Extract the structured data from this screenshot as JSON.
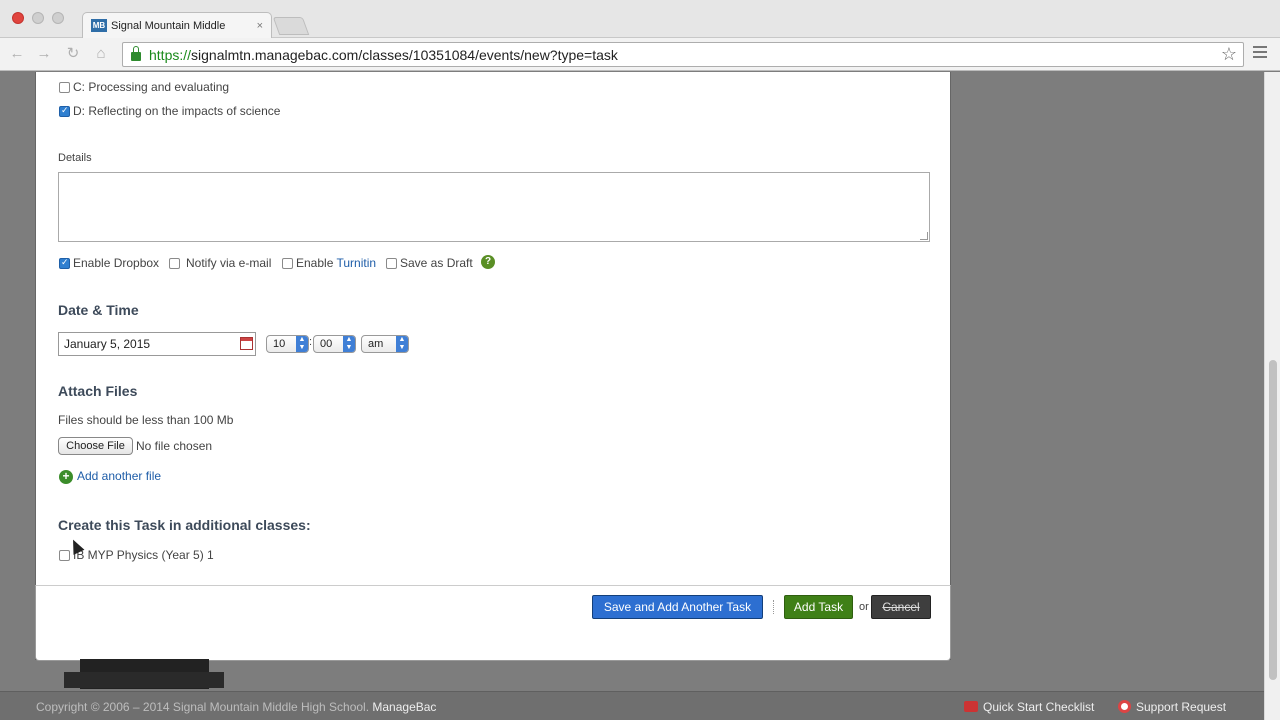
{
  "browser": {
    "tab": {
      "favicon": "MB",
      "title": "Signal Mountain Middle",
      "close": "×"
    },
    "url": {
      "scheme": "https://",
      "rest": "signalmtn.managebac.com/classes/10351084/events/new?type=task"
    },
    "icons": {
      "back": "back-arrow-icon",
      "forward": "forward-arrow-icon",
      "reload": "reload-icon",
      "home": "home-icon",
      "bookmark": "star-icon",
      "menu": "hamburger-menu-icon"
    }
  },
  "criteria": {
    "items": [
      {
        "label": "C: Processing and evaluating",
        "checked": false
      },
      {
        "label": "D: Reflecting on the impacts of science",
        "checked": true
      }
    ]
  },
  "details": {
    "label": "Details",
    "value": ""
  },
  "options": {
    "dropbox": {
      "label": "Enable Dropbox",
      "checked": true
    },
    "notify": {
      "label": "Notify via e-mail",
      "checked": false
    },
    "turnitin_prefix": "Enable ",
    "turnitin_link": "Turnitin",
    "turnitin_checked": false,
    "draft": {
      "label": "Save as Draft",
      "checked": false
    },
    "help": "?"
  },
  "datetime": {
    "heading": "Date & Time",
    "date": "January 5, 2015",
    "hour": "10",
    "minute": "00",
    "ampm": "am",
    "separator": ":"
  },
  "files": {
    "heading": "Attach Files",
    "note": "Files should be less than 100 Mb",
    "choose_button": "Choose File",
    "status": "No file chosen",
    "add_another": "Add another file",
    "add_icon_glyph": "+"
  },
  "additional": {
    "heading": "Create this Task in additional classes:",
    "classes": [
      {
        "label": "IB MYP Physics (Year 5) 1",
        "checked": false
      }
    ]
  },
  "actions": {
    "save_another": "Save and Add Another Task",
    "add_task": "Add Task",
    "or": "or",
    "cancel": "Cancel"
  },
  "footer": {
    "copyright": "Copyright © 2006 – 2014 Signal Mountain Middle High School.",
    "brand": "ManageBac",
    "quick_start": "Quick Start Checklist",
    "support": "Support Request"
  },
  "colors": {
    "primary_button": "#2d6fd1",
    "success_button": "#3f8017",
    "cancel_button": "#3e3e3e",
    "heading": "#3d4a5a",
    "link": "#1e5da8"
  }
}
